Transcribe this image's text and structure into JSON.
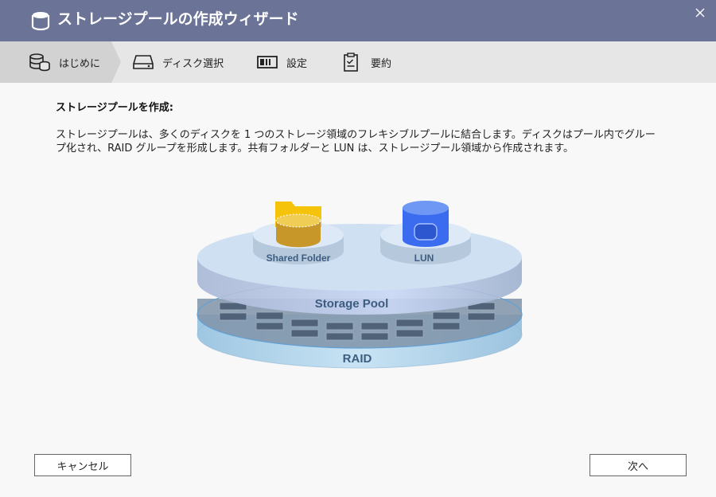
{
  "window": {
    "title": "ストレージプールの作成ウィザード"
  },
  "steps": [
    {
      "label": "はじめに",
      "icon": "database-icon",
      "active": true
    },
    {
      "label": "ディスク選択",
      "icon": "disk-icon",
      "active": false
    },
    {
      "label": "設定",
      "icon": "settings-panel-icon",
      "active": false
    },
    {
      "label": "要約",
      "icon": "clipboard-icon",
      "active": false
    }
  ],
  "content": {
    "heading": "ストレージプールを作成:",
    "description_line1": "ストレージプールは、多くのディスクを 1 つのストレージ領域のフレキシブルプールに結合します。ディスクはプール内でグルー",
    "description_line2": "プ化され、RAID グループを形成します。共有フォルダーと LUN は、ストレージプール領域から作成されます。"
  },
  "illustration": {
    "shared_folder_label": "Shared Folder",
    "lun_label": "LUN",
    "storage_pool_label": "Storage Pool",
    "raid_label": "RAID"
  },
  "buttons": {
    "cancel": "キャンセル",
    "next": "次へ"
  },
  "colors": {
    "titlebar": "#6b7396",
    "steps_bar": "#e6e6e6",
    "active_step": "#d2d2d2"
  }
}
